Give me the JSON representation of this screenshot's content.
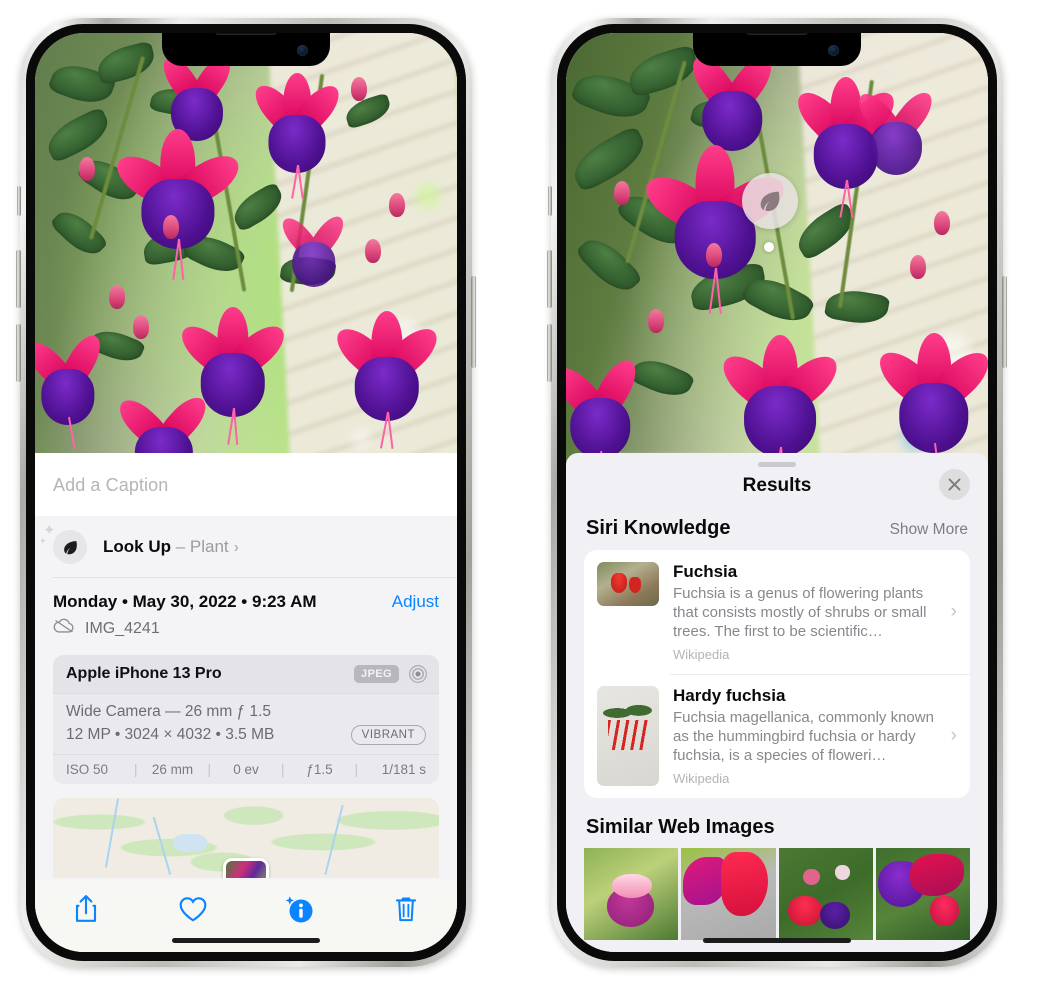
{
  "left_phone": {
    "caption_placeholder": "Add a Caption",
    "lookup": {
      "label": "Look Up",
      "dash": " – ",
      "subject": "Plant",
      "chevron": "›",
      "icon": "leaf-icon"
    },
    "date_text": "Monday • May 30, 2022 • 9:23 AM",
    "adjust_label": "Adjust",
    "file_name": "IMG_4241",
    "cloud_icon": "icloud-slash-icon",
    "camera": {
      "device": "Apple iPhone 13 Pro",
      "format_badge": "JPEG",
      "aperture_icon": "aperture-icon",
      "lens_line": "Wide Camera — 26 mm ƒ 1.5",
      "size_line": "12 MP • 3024 × 4032 • 3.5 MB",
      "vibrant_badge": "VIBRANT",
      "exif": [
        "ISO 50",
        "26 mm",
        "0 ev",
        "ƒ1.5",
        "1/181 s"
      ]
    },
    "toolbar": [
      {
        "name": "share-button",
        "icon": "share-icon"
      },
      {
        "name": "favorite-button",
        "icon": "heart-icon"
      },
      {
        "name": "info-button",
        "icon": "info-sparkle-icon"
      },
      {
        "name": "delete-button",
        "icon": "trash-icon"
      }
    ]
  },
  "right_phone": {
    "visual_lookup_badge_icon": "leaf-icon",
    "sheet_title": "Results",
    "close_icon": "close-icon",
    "siri_knowledge": {
      "title": "Siri Knowledge",
      "show_more": "Show More",
      "items": [
        {
          "name": "Fuchsia",
          "description": "Fuchsia is a genus of flowering plants that consists mostly of shrubs or small trees. The first to be scientific…",
          "source": "Wikipedia",
          "chevron": "›"
        },
        {
          "name": "Hardy fuchsia",
          "description": "Fuchsia magellanica, commonly known as the hummingbird fuchsia or hardy fuchsia, is a species of floweri…",
          "source": "Wikipedia",
          "chevron": "›"
        }
      ]
    },
    "similar_web_images": {
      "title": "Similar Web Images",
      "count": 4
    }
  },
  "colors": {
    "accent_blue": "#0a84ff",
    "sheet_bg": "#f1f1f5",
    "card_bg": "#ffffff",
    "secondary_text": "#87878e"
  }
}
